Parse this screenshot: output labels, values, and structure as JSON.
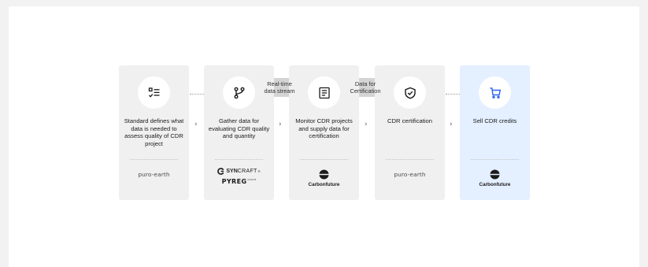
{
  "steps": [
    {
      "label": "Standard defines what data is needed to assess quality of CDR project",
      "icon": "checklist-icon",
      "logos": [
        "puro.earth"
      ]
    },
    {
      "label": "Gather data for evaluating CDR quality and quantity",
      "icon": "git-branch-icon",
      "logos": [
        "SYNCRAFT",
        "PYREG"
      ]
    },
    {
      "label": "Monitor CDR projects and supply data for certification",
      "icon": "document-list-icon",
      "logos": [
        "Carbonfuture"
      ]
    },
    {
      "label": "CDR certification",
      "icon": "shield-check-icon",
      "logos": [
        "puro.earth"
      ]
    },
    {
      "label": "Sell CDR credits",
      "icon": "shopping-cart-icon",
      "logos": [
        "Carbonfuture"
      ]
    }
  ],
  "streams": [
    {
      "label_line1": "Real-time",
      "label_line2": "data stream"
    },
    {
      "label_line1": "Data for",
      "label_line2": "Certification"
    }
  ],
  "logos": {
    "puro": "puro-earth",
    "carbonfuture": "Carbonfuture",
    "syncraft_bold": "SYN",
    "syncraft_light": "CRAFT",
    "syncraft_reg": "®",
    "pyreg": "PYREG",
    "pyreg_sup": "GmbH"
  },
  "chevron": "›",
  "colors": {
    "page_bg": "#f2f2f2",
    "canvas_bg": "#ffffff",
    "card_bg": "#f0f0f0",
    "card_highlight_bg": "#e4efff",
    "accent_blue": "#2a63f0",
    "arrow_gray": "#d4d4d4",
    "text": "#1b1b1b"
  }
}
